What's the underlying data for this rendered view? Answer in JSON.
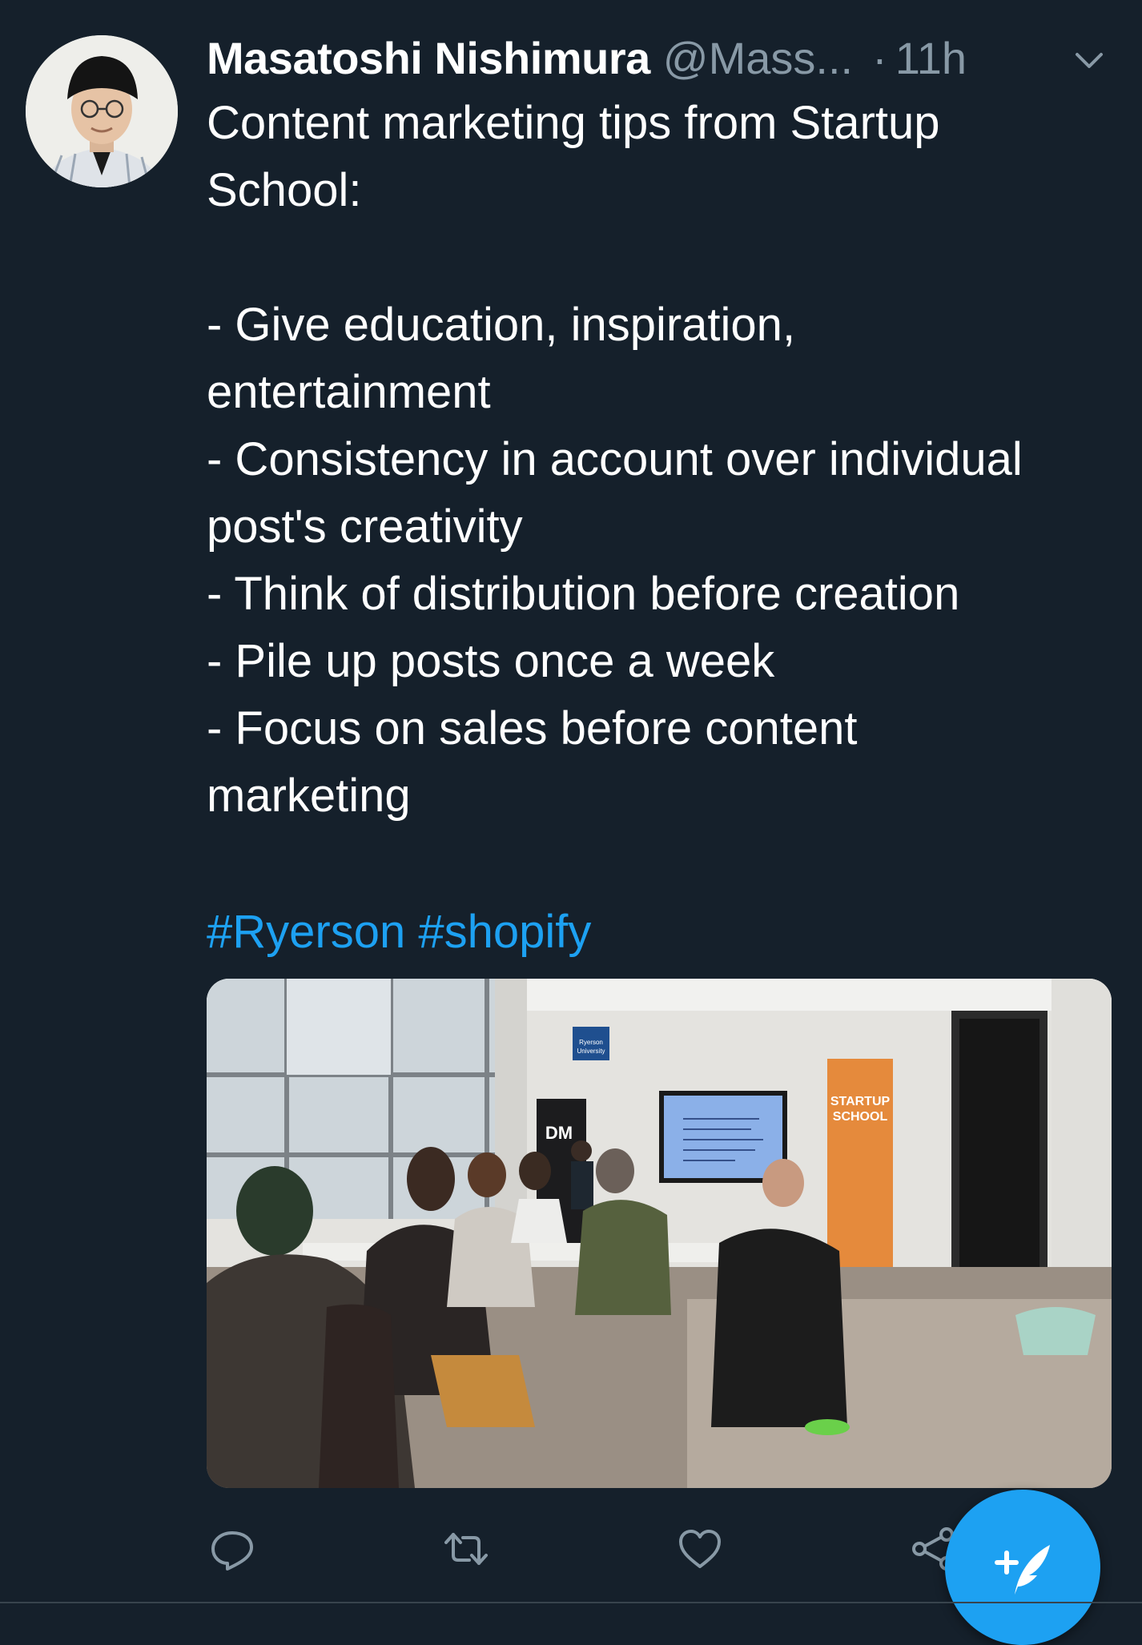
{
  "tweet": {
    "author": {
      "display_name": "Masatoshi Nishimura",
      "handle": "@Mass...",
      "avatar_icon": "profile-photo"
    },
    "separator": "·",
    "timestamp": "11h",
    "body_lines": [
      "Content marketing tips from Startup",
      "School:",
      "",
      "- Give education, inspiration,",
      "entertainment",
      "- Consistency in account over individual",
      "post's creativity",
      "- Think of distribution before creation",
      "- Pile up posts once a week",
      "- Focus on sales before content",
      "marketing"
    ],
    "hashtags": [
      "#Ryerson",
      "#shopify"
    ],
    "media": {
      "type": "photo",
      "visible_signage": [
        "Ryerson University",
        "DM",
        "STARTUP SCHOOL"
      ]
    },
    "actions": {
      "reply_icon": "reply-icon",
      "retweet_icon": "retweet-icon",
      "like_icon": "heart-icon",
      "share_icon": "share-icon"
    }
  },
  "fab": {
    "icon": "compose-tweet-icon"
  },
  "colors": {
    "background": "#15202b",
    "accent": "#1da1f2",
    "muted": "#8899a6",
    "divider": "#38444d"
  }
}
